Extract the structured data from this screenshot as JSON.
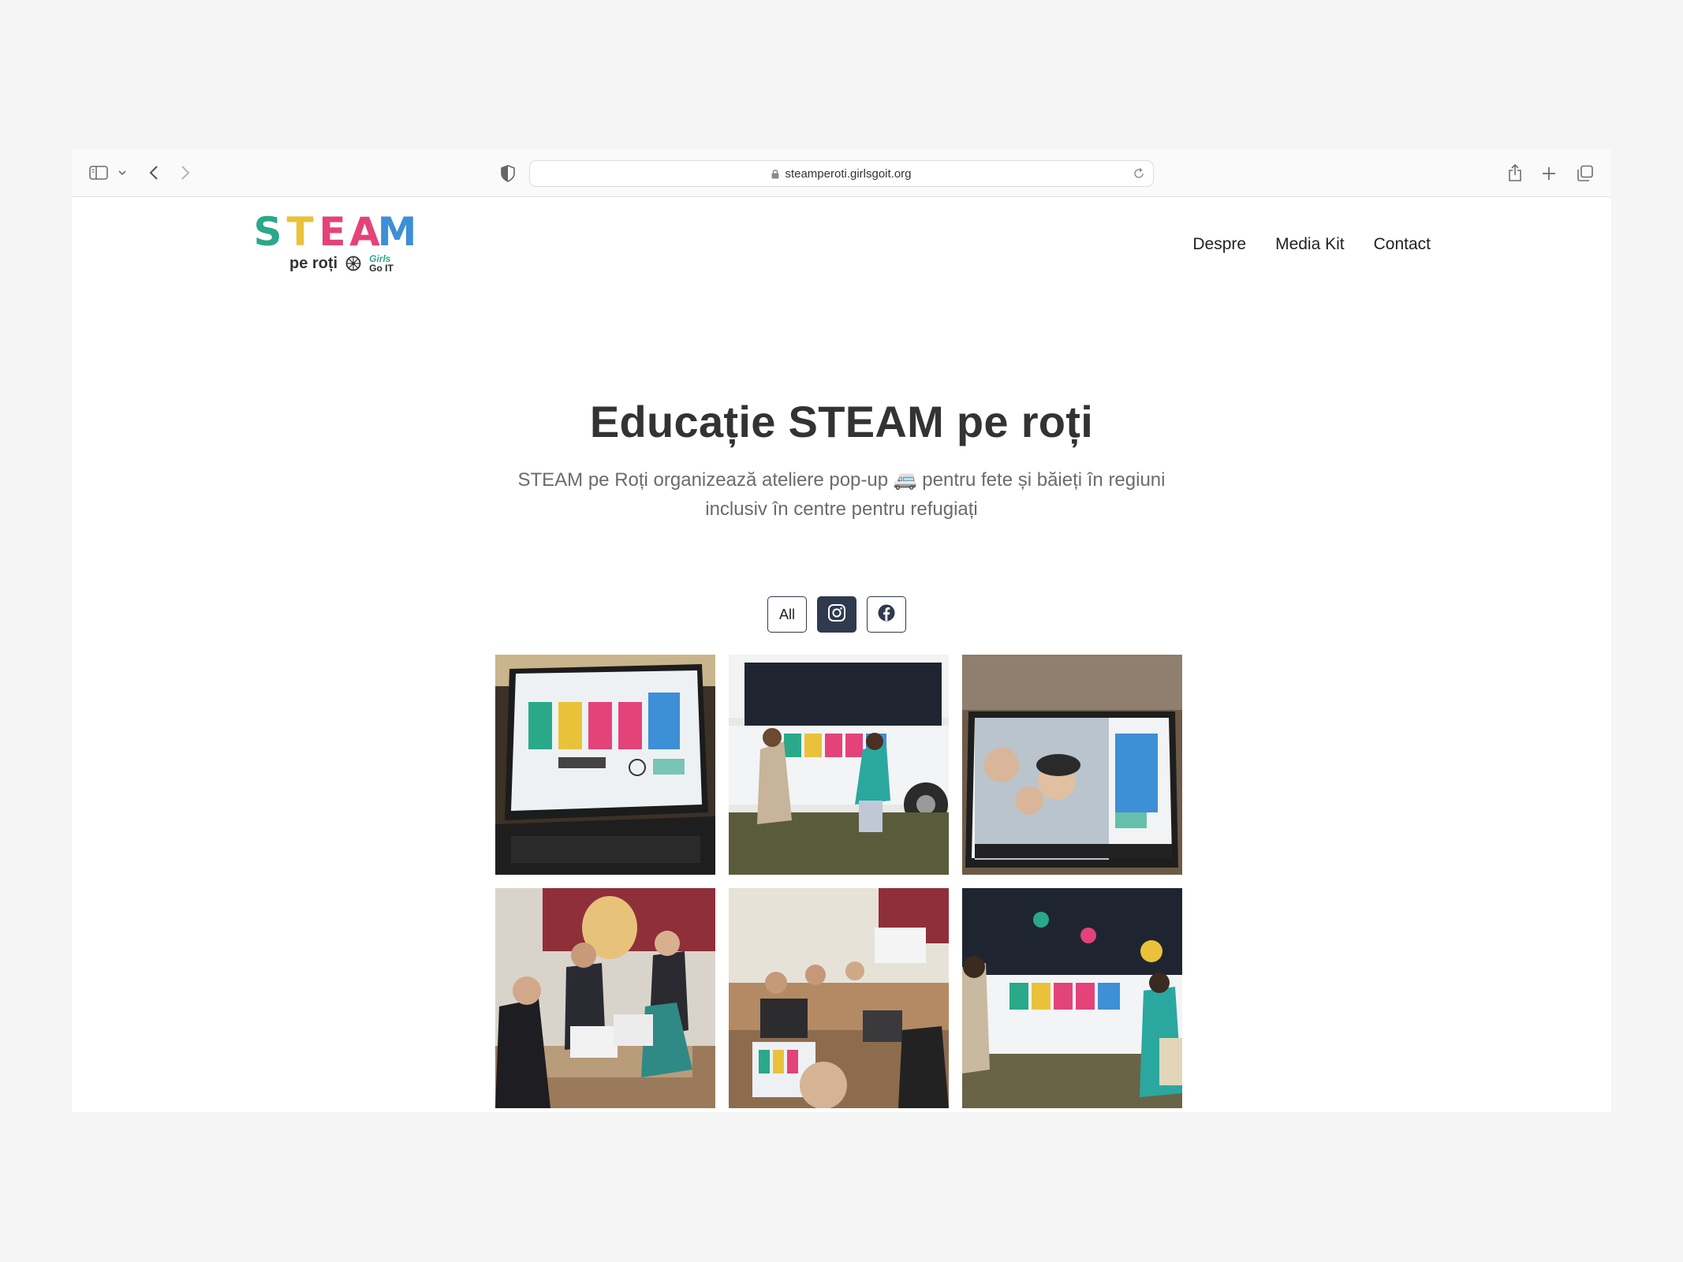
{
  "browser": {
    "url": "steamperoti.girlsgoit.org",
    "icons": [
      "sidebar-icon",
      "chevron-down-icon",
      "back-icon",
      "forward-icon",
      "shield-icon",
      "lock-icon",
      "reload-icon",
      "share-icon",
      "new-tab-icon",
      "tabs-overview-icon"
    ]
  },
  "site": {
    "logo": {
      "letters": [
        "S",
        "T",
        "E",
        "A",
        "M"
      ],
      "subtitle": "pe roți",
      "partner_top": "Girls",
      "partner_bottom": "Go IT"
    },
    "nav": [
      "Despre",
      "Media Kit",
      "Contact"
    ],
    "hero": {
      "title": "Educație STEAM pe roți",
      "subtitle_line1": "STEAM pe Roți organizează ateliere pop-up 🚐 pentru fete și băieți în regiuni",
      "subtitle_line2": "inclusiv în centre pentru refugiați"
    },
    "filters": {
      "all_label": "All",
      "instagram_icon": "instagram-icon",
      "facebook_icon": "facebook-icon",
      "active": "instagram"
    },
    "gallery": {
      "count": 6,
      "photos": [
        "laptop-logo-photo",
        "van-logo-photo",
        "laptop-selfie-photo",
        "classroom-group-photo",
        "classroom-laptops-photo",
        "van-side-photo"
      ]
    }
  },
  "colors": {
    "page_bg": "#f5f5f5",
    "heading": "#333333",
    "subtitle": "#6b6b6b",
    "filter_dark": "#2f3a4e",
    "logo_teal": "#2aa88a",
    "logo_yellow": "#e9c23a",
    "logo_pink": "#e4437a",
    "logo_blue": "#3d8fd6"
  }
}
